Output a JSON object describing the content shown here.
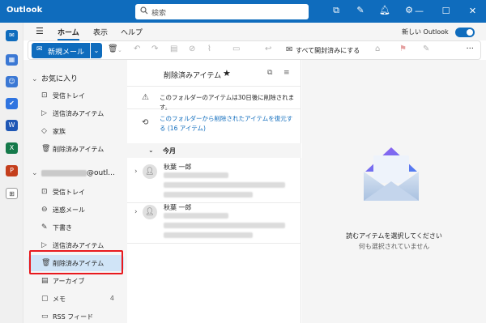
{
  "titlebar": {
    "app_title": "Outlook",
    "search_placeholder": "検索"
  },
  "menubar": {
    "tabs": [
      {
        "label": "ホーム",
        "active": true
      },
      {
        "label": "表示",
        "active": false
      },
      {
        "label": "ヘルプ",
        "active": false
      }
    ],
    "new_outlook_label": "新しい Outlook",
    "new_outlook_on": true
  },
  "ribbon": {
    "new_mail_label": "新規メール",
    "mark_all_read_label": "すべて開封済みにする"
  },
  "folders": {
    "favorites_header": "お気に入り",
    "favorites": [
      {
        "label": "受信トレイ",
        "icon": "inbox-icon"
      },
      {
        "label": "送信済みアイテム",
        "icon": "send-icon"
      },
      {
        "label": "家族",
        "icon": "tag-icon"
      },
      {
        "label": "削除済みアイテム",
        "icon": "trash-icon"
      }
    ],
    "account_suffix": "@outl...",
    "account_items": [
      {
        "label": "受信トレイ",
        "icon": "inbox-icon",
        "count": ""
      },
      {
        "label": "迷惑メール",
        "icon": "junk-icon",
        "count": ""
      },
      {
        "label": "下書き",
        "icon": "draft-icon",
        "count": ""
      },
      {
        "label": "送信済みアイテム",
        "icon": "send-icon",
        "count": ""
      },
      {
        "label": "削除済みアイテム",
        "icon": "trash-icon",
        "count": "",
        "selected": true
      },
      {
        "label": "アーカイブ",
        "icon": "archive-icon",
        "count": ""
      },
      {
        "label": "メモ",
        "icon": "note-icon",
        "count": "4"
      },
      {
        "label": "RSS フィード",
        "icon": "folder-icon",
        "count": ""
      }
    ]
  },
  "list": {
    "title": "削除済みアイテム",
    "notice1": "このフォルダーのアイテムは30日後に削除されます。",
    "notice2": "このフォルダーから削除されたアイテムを復元する (16 アイテム)",
    "group_label": "今月",
    "messages": [
      {
        "sender": "秋葉 一郎"
      },
      {
        "sender": "秋葉 一郎"
      }
    ]
  },
  "reading": {
    "empty_title": "読むアイテムを選択してください",
    "empty_sub": "何も選択されていません"
  },
  "colors": {
    "accent": "#0f6cbd",
    "selected_bg": "#d0e4f7",
    "highlight_box": "#e8191e"
  }
}
